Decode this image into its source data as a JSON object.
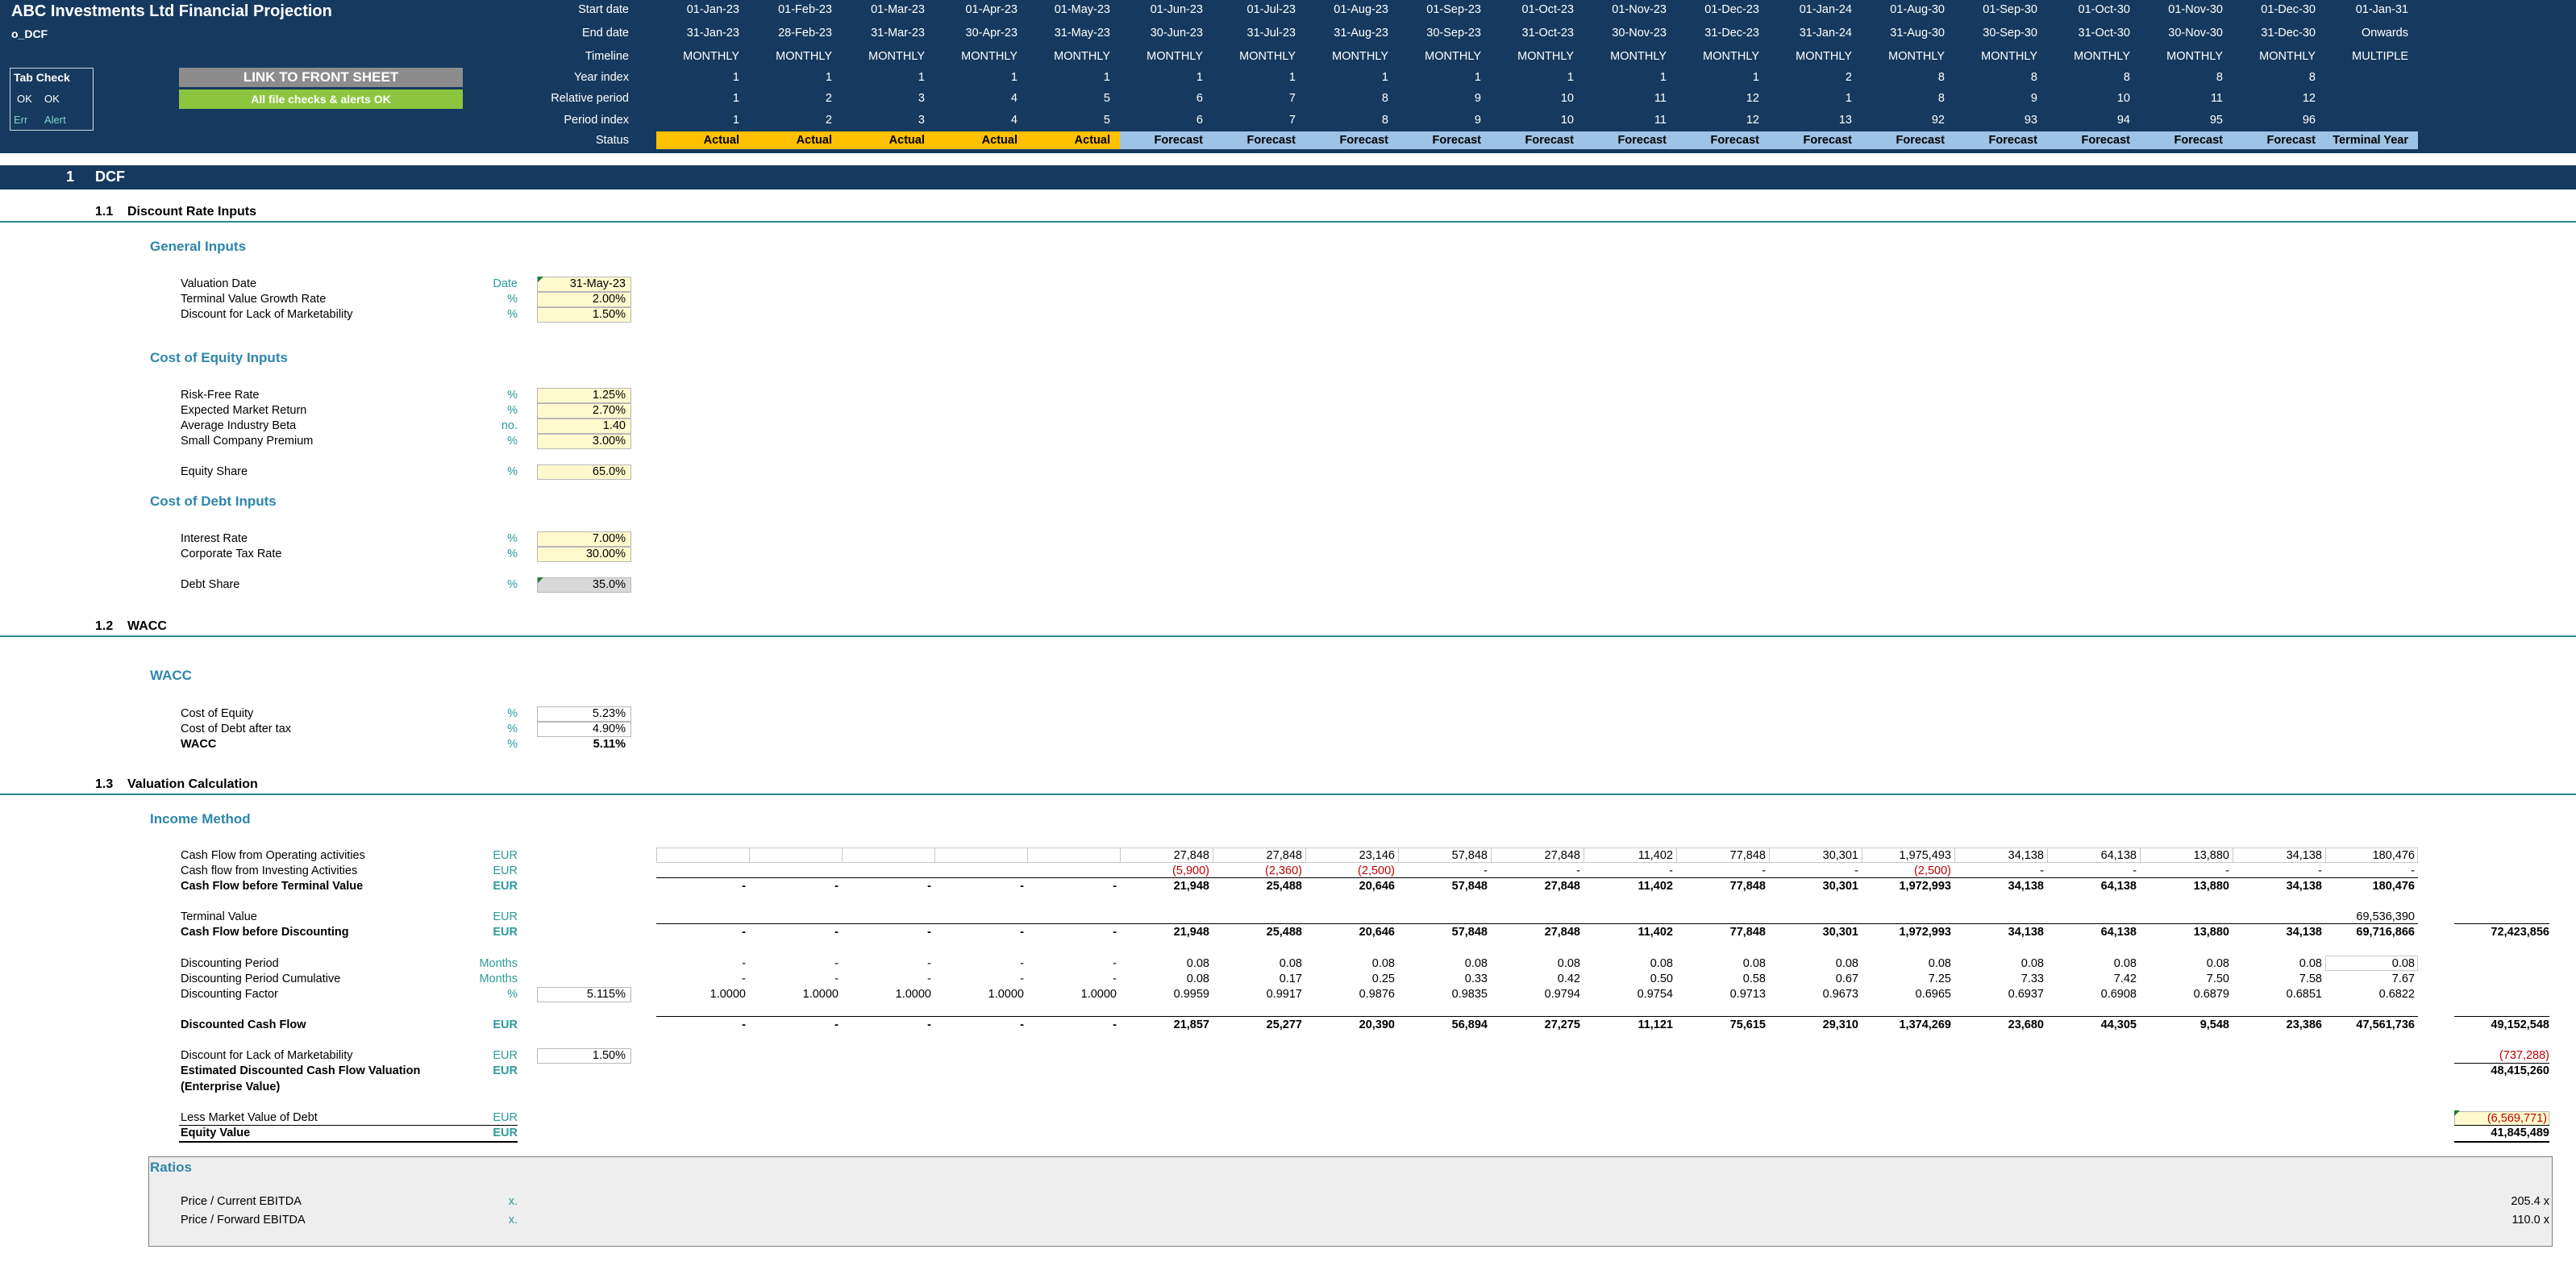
{
  "header": {
    "title": "ABC Investments Ltd Financial Projection",
    "sheet": "o_DCF",
    "tab_check": {
      "title": "Tab Check",
      "ok1": "OK",
      "ok2": "OK",
      "err": "Err",
      "alert": "Alert"
    },
    "link_button": "LINK TO FRONT SHEET",
    "checks_ok": "All file checks & alerts OK",
    "row_labels": [
      "Start date",
      "End date",
      "Timeline",
      "Year index",
      "Relative period",
      "Period index",
      "Status"
    ],
    "columns": [
      {
        "start": "01-Jan-23",
        "end": "31-Jan-23",
        "tl": "MONTHLY",
        "yi": "1",
        "rp": "1",
        "pi": "1",
        "status": "Actual"
      },
      {
        "start": "01-Feb-23",
        "end": "28-Feb-23",
        "tl": "MONTHLY",
        "yi": "1",
        "rp": "2",
        "pi": "2",
        "status": "Actual"
      },
      {
        "start": "01-Mar-23",
        "end": "31-Mar-23",
        "tl": "MONTHLY",
        "yi": "1",
        "rp": "3",
        "pi": "3",
        "status": "Actual"
      },
      {
        "start": "01-Apr-23",
        "end": "30-Apr-23",
        "tl": "MONTHLY",
        "yi": "1",
        "rp": "4",
        "pi": "4",
        "status": "Actual"
      },
      {
        "start": "01-May-23",
        "end": "31-May-23",
        "tl": "MONTHLY",
        "yi": "1",
        "rp": "5",
        "pi": "5",
        "status": "Actual"
      },
      {
        "start": "01-Jun-23",
        "end": "30-Jun-23",
        "tl": "MONTHLY",
        "yi": "1",
        "rp": "6",
        "pi": "6",
        "status": "Forecast"
      },
      {
        "start": "01-Jul-23",
        "end": "31-Jul-23",
        "tl": "MONTHLY",
        "yi": "1",
        "rp": "7",
        "pi": "7",
        "status": "Forecast"
      },
      {
        "start": "01-Aug-23",
        "end": "31-Aug-23",
        "tl": "MONTHLY",
        "yi": "1",
        "rp": "8",
        "pi": "8",
        "status": "Forecast"
      },
      {
        "start": "01-Sep-23",
        "end": "30-Sep-23",
        "tl": "MONTHLY",
        "yi": "1",
        "rp": "9",
        "pi": "9",
        "status": "Forecast"
      },
      {
        "start": "01-Oct-23",
        "end": "31-Oct-23",
        "tl": "MONTHLY",
        "yi": "1",
        "rp": "10",
        "pi": "10",
        "status": "Forecast"
      },
      {
        "start": "01-Nov-23",
        "end": "30-Nov-23",
        "tl": "MONTHLY",
        "yi": "1",
        "rp": "11",
        "pi": "11",
        "status": "Forecast"
      },
      {
        "start": "01-Dec-23",
        "end": "31-Dec-23",
        "tl": "MONTHLY",
        "yi": "1",
        "rp": "12",
        "pi": "12",
        "status": "Forecast"
      },
      {
        "start": "01-Jan-24",
        "end": "31-Jan-24",
        "tl": "MONTHLY",
        "yi": "2",
        "rp": "1",
        "pi": "13",
        "status": "Forecast"
      },
      {
        "start": "01-Aug-30",
        "end": "31-Aug-30",
        "tl": "MONTHLY",
        "yi": "8",
        "rp": "8",
        "pi": "92",
        "status": "Forecast"
      },
      {
        "start": "01-Sep-30",
        "end": "30-Sep-30",
        "tl": "MONTHLY",
        "yi": "8",
        "rp": "9",
        "pi": "93",
        "status": "Forecast"
      },
      {
        "start": "01-Oct-30",
        "end": "31-Oct-30",
        "tl": "MONTHLY",
        "yi": "8",
        "rp": "10",
        "pi": "94",
        "status": "Forecast"
      },
      {
        "start": "01-Nov-30",
        "end": "30-Nov-30",
        "tl": "MONTHLY",
        "yi": "8",
        "rp": "11",
        "pi": "95",
        "status": "Forecast"
      },
      {
        "start": "01-Dec-30",
        "end": "31-Dec-30",
        "tl": "MONTHLY",
        "yi": "8",
        "rp": "12",
        "pi": "96",
        "status": "Forecast"
      },
      {
        "start": "01-Jan-31",
        "end": "Onwards",
        "tl": "MULTIPLE",
        "yi": "",
        "rp": "",
        "pi": "",
        "status": "Terminal Year"
      }
    ]
  },
  "section1": {
    "num": "1",
    "title": "DCF"
  },
  "s11": {
    "num": "1.1",
    "title": "Discount Rate Inputs"
  },
  "general": {
    "title": "General Inputs",
    "rows": [
      {
        "label": "Valuation Date",
        "unit": "Date",
        "value": "31-May-23"
      },
      {
        "label": "Terminal Value Growth Rate",
        "unit": "%",
        "value": "2.00%"
      },
      {
        "label": "Discount for Lack of Marketability",
        "unit": "%",
        "value": "1.50%"
      }
    ]
  },
  "coe": {
    "title": "Cost of Equity Inputs",
    "rows": [
      {
        "label": "Risk-Free Rate",
        "unit": "%",
        "value": "1.25%"
      },
      {
        "label": "Expected Market Return",
        "unit": "%",
        "value": "2.70%"
      },
      {
        "label": "Average Industry Beta",
        "unit": "no.",
        "value": "1.40"
      },
      {
        "label": "Small Company Premium",
        "unit": "%",
        "value": "3.00%"
      }
    ],
    "equity_share": {
      "label": "Equity Share",
      "unit": "%",
      "value": "65.0%"
    }
  },
  "cod": {
    "title": "Cost of Debt Inputs",
    "rows": [
      {
        "label": "Interest Rate",
        "unit": "%",
        "value": "7.00%"
      },
      {
        "label": "Corporate Tax Rate",
        "unit": "%",
        "value": "30.00%"
      }
    ],
    "debt_share": {
      "label": "Debt Share",
      "unit": "%",
      "value": "35.0%"
    }
  },
  "s12": {
    "num": "1.2",
    "title": "WACC"
  },
  "wacc": {
    "title": "WACC",
    "rows": [
      {
        "label": "Cost of Equity",
        "unit": "%",
        "value": "5.23%"
      },
      {
        "label": "Cost of Debt after tax",
        "unit": "%",
        "value": "4.90%"
      },
      {
        "label": "WACC",
        "unit": "%",
        "value": "5.11%"
      }
    ]
  },
  "s13": {
    "num": "1.3",
    "title": "Valuation Calculation"
  },
  "income": {
    "title": "Income Method",
    "rows": {
      "cfo": {
        "label": "Cash Flow from Operating activities",
        "unit": "EUR",
        "vals": [
          "",
          "",
          "",
          "",
          "",
          "27,848",
          "27,848",
          "23,146",
          "57,848",
          "27,848",
          "11,402",
          "77,848",
          "30,301",
          "1,975,493",
          "34,138",
          "64,138",
          "13,880",
          "34,138",
          "180,476"
        ]
      },
      "cfi": {
        "label": "Cash flow from Investing Activities",
        "unit": "EUR",
        "vals": [
          "",
          "",
          "",
          "",
          "",
          "(5,900)",
          "(2,360)",
          "(2,500)",
          "-",
          "-",
          "-",
          "-",
          "-",
          "(2,500)",
          "-",
          "-",
          "-",
          "-",
          "-"
        ]
      },
      "cfbt": {
        "label": "Cash Flow before Terminal Value",
        "unit": "EUR",
        "vals": [
          "-",
          "-",
          "-",
          "-",
          "-",
          "21,948",
          "25,488",
          "20,646",
          "57,848",
          "27,848",
          "11,402",
          "77,848",
          "30,301",
          "1,972,993",
          "34,138",
          "64,138",
          "13,880",
          "34,138",
          "180,476"
        ]
      },
      "tv": {
        "label": "Terminal Value",
        "unit": "EUR",
        "vals": [
          "",
          "",
          "",
          "",
          "",
          "",
          "",
          "",
          "",
          "",
          "",
          "",
          "",
          "",
          "",
          "",
          "",
          "",
          "69,536,390"
        ]
      },
      "cfbd": {
        "label": "Cash Flow before Discounting",
        "unit": "EUR",
        "vals": [
          "-",
          "-",
          "-",
          "-",
          "-",
          "21,948",
          "25,488",
          "20,646",
          "57,848",
          "27,848",
          "11,402",
          "77,848",
          "30,301",
          "1,972,993",
          "34,138",
          "64,138",
          "13,880",
          "34,138",
          "69,716,866"
        ],
        "total": "72,423,856"
      },
      "dp": {
        "label": "Discounting Period",
        "unit": "Months",
        "vals": [
          "-",
          "-",
          "-",
          "-",
          "-",
          "0.08",
          "0.08",
          "0.08",
          "0.08",
          "0.08",
          "0.08",
          "0.08",
          "0.08",
          "0.08",
          "0.08",
          "0.08",
          "0.08",
          "0.08",
          "0.08"
        ]
      },
      "dpc": {
        "label": "Discounting Period Cumulative",
        "unit": "Months",
        "vals": [
          "-",
          "-",
          "-",
          "-",
          "-",
          "0.08",
          "0.17",
          "0.25",
          "0.33",
          "0.42",
          "0.50",
          "0.58",
          "0.67",
          "7.25",
          "7.33",
          "7.42",
          "7.50",
          "7.58",
          "7.67"
        ]
      },
      "df": {
        "label": "Discounting Factor",
        "unit": "%",
        "input": "5.115%",
        "vals": [
          "1.0000",
          "1.0000",
          "1.0000",
          "1.0000",
          "1.0000",
          "0.9959",
          "0.9917",
          "0.9876",
          "0.9835",
          "0.9794",
          "0.9754",
          "0.9713",
          "0.9673",
          "0.6965",
          "0.6937",
          "0.6908",
          "0.6879",
          "0.6851",
          "0.6822"
        ]
      },
      "dcf": {
        "label": "Discounted Cash Flow",
        "unit": "EUR",
        "vals": [
          "-",
          "-",
          "-",
          "-",
          "-",
          "21,857",
          "25,277",
          "20,390",
          "56,894",
          "27,275",
          "11,121",
          "75,615",
          "29,310",
          "1,374,269",
          "23,680",
          "44,305",
          "9,548",
          "23,386",
          "47,561,736"
        ],
        "total": "49,152,548"
      },
      "dlm": {
        "label": "Discount for Lack of Marketability",
        "unit": "EUR",
        "input": "1.50%",
        "total": "(737,288)"
      },
      "edcf": {
        "label": "Estimated Discounted Cash Flow Valuation",
        "label2": "(Enterprise Value)",
        "unit": "EUR",
        "total": "48,415,260"
      },
      "lmvd": {
        "label": "Less Market Value of Debt",
        "unit": "EUR",
        "total": "(6,569,771)"
      },
      "eq": {
        "label": "Equity Value",
        "unit": "EUR",
        "total": "41,845,489"
      }
    }
  },
  "ratios": {
    "title": "Ratios",
    "rows": [
      {
        "label": "Price / Current EBITDA",
        "unit": "x.",
        "value": "205.4 x"
      },
      {
        "label": "Price / Forward EBITDA",
        "unit": "x.",
        "value": "110.0 x"
      }
    ]
  }
}
